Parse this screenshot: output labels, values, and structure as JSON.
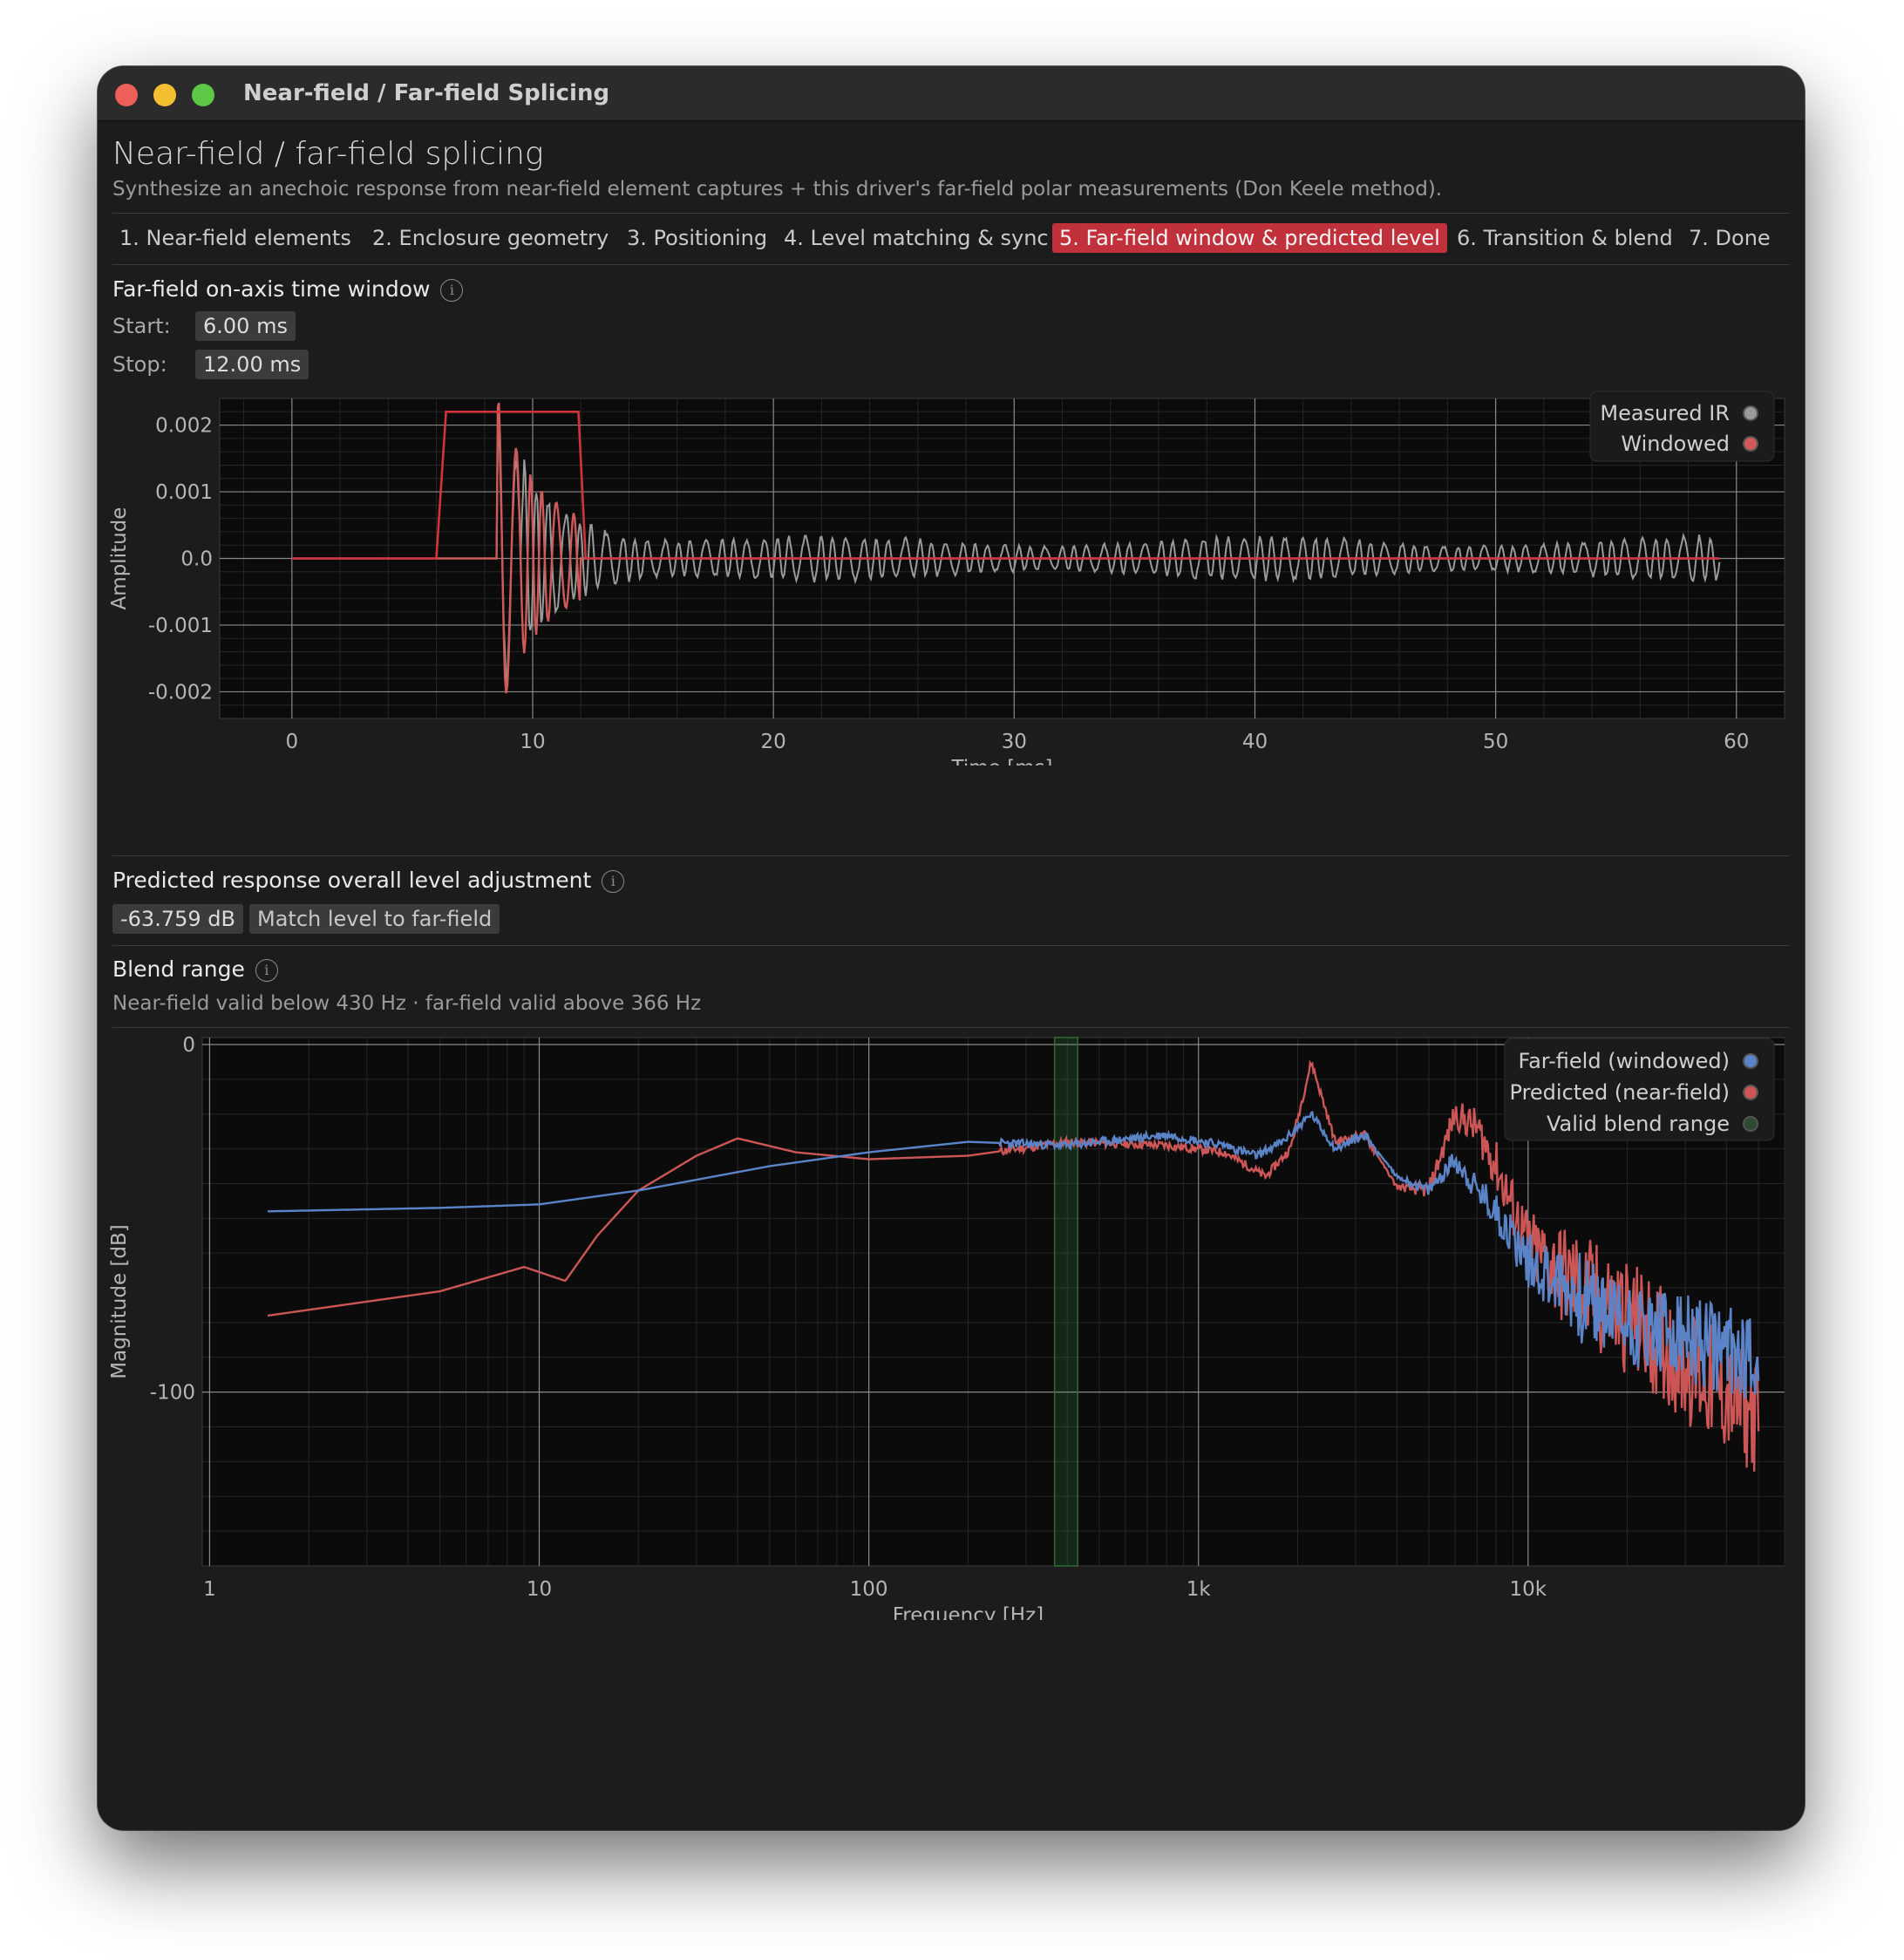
{
  "window": {
    "title": "Near-field / Far-field Splicing"
  },
  "header": {
    "title": "Near-field / far-field splicing",
    "subtitle": "Synthesize an anechoic response from near-field element captures + this driver's far-field polar measurements (Don Keele method)."
  },
  "tabs": [
    {
      "label": "1. Near-field elements",
      "active": false
    },
    {
      "label": "2. Enclosure geometry",
      "active": false
    },
    {
      "label": "3. Positioning",
      "active": false
    },
    {
      "label": "4. Level matching & sync",
      "active": false
    },
    {
      "label": "5. Far-field window & predicted level",
      "active": true
    },
    {
      "label": "6. Transition & blend",
      "active": false
    },
    {
      "label": "7. Done",
      "active": false
    }
  ],
  "window_section": {
    "title": "Far-field on-axis time window",
    "start_label": "Start:",
    "start_value": "6.00 ms",
    "stop_label": "Stop:",
    "stop_value": "12.00 ms"
  },
  "level_section": {
    "title": "Predicted response overall level adjustment",
    "value": "-63.759 dB",
    "match_button": "Match level to far-field"
  },
  "blend_section": {
    "title": "Blend range",
    "note": "Near-field valid below 430 Hz · far-field valid above 366 Hz"
  },
  "colors": {
    "accent": "#c0313c",
    "measured": "#9a9a9a",
    "windowed": "#d05a5a",
    "farfield": "#5b84c8",
    "predicted": "#cc5656",
    "blend": "#2f6b35"
  },
  "chart_data": [
    {
      "type": "line",
      "xlabel": "Time [ms]",
      "ylabel": "Amplitude",
      "xlim": [
        -3,
        62
      ],
      "ylim": [
        -0.0024,
        0.0024
      ],
      "x_ticks": [
        "0",
        "10",
        "20",
        "30",
        "40",
        "50",
        "60"
      ],
      "y_ticks": [
        "0.002",
        "0.001",
        "0.0",
        "-0.001",
        "-0.002"
      ],
      "grid": true,
      "legend": "top-right",
      "series": [
        {
          "name": "Measured IR",
          "color": "#9a9a9a",
          "x_range": [
            0,
            59.3
          ],
          "onset_ms": 8.5,
          "peak": 0.0022
        },
        {
          "name": "Windowed",
          "color": "#d05a5a",
          "window_ms": [
            6.0,
            12.0
          ],
          "window_level": 0.0022
        }
      ]
    },
    {
      "type": "line",
      "xlabel": "Frequency [Hz]",
      "ylabel": "Magnitude [dB]",
      "xscale": "log",
      "xlim": [
        0.95,
        60000
      ],
      "ylim": [
        -150,
        2
      ],
      "x_ticks": [
        "1",
        "10",
        "100",
        "1k",
        "10k"
      ],
      "y_ticks": [
        "0",
        "-100"
      ],
      "grid": true,
      "legend": "top-right",
      "series": [
        {
          "name": "Far-field (windowed)",
          "color": "#5b84c8",
          "points": [
            [
              1.5,
              -48
            ],
            [
              5,
              -47
            ],
            [
              10,
              -46
            ],
            [
              20,
              -42
            ],
            [
              50,
              -35
            ],
            [
              100,
              -31
            ],
            [
              200,
              -28
            ],
            [
              400,
              -29
            ],
            [
              800,
              -26
            ],
            [
              1200,
              -29
            ],
            [
              1500,
              -32
            ],
            [
              1800,
              -28
            ],
            [
              2200,
              -20
            ],
            [
              2600,
              -30
            ],
            [
              3200,
              -26
            ],
            [
              4000,
              -38
            ],
            [
              5000,
              -42
            ],
            [
              6000,
              -33
            ],
            [
              7000,
              -42
            ],
            [
              8000,
              -48
            ],
            [
              10000,
              -62
            ],
            [
              15000,
              -74
            ],
            [
              20000,
              -80
            ],
            [
              30000,
              -85
            ],
            [
              50000,
              -90
            ]
          ]
        },
        {
          "name": "Predicted (near-field)",
          "color": "#cc5656",
          "points": [
            [
              1.5,
              -78
            ],
            [
              5,
              -71
            ],
            [
              9,
              -64
            ],
            [
              12,
              -68
            ],
            [
              15,
              -55
            ],
            [
              20,
              -42
            ],
            [
              30,
              -32
            ],
            [
              40,
              -27
            ],
            [
              60,
              -31
            ],
            [
              100,
              -33
            ],
            [
              200,
              -32
            ],
            [
              400,
              -28
            ],
            [
              800,
              -29
            ],
            [
              1200,
              -31
            ],
            [
              1600,
              -38
            ],
            [
              1900,
              -30
            ],
            [
              2200,
              -5
            ],
            [
              2600,
              -28
            ],
            [
              3200,
              -26
            ],
            [
              4000,
              -41
            ],
            [
              5000,
              -42
            ],
            [
              6000,
              -20
            ],
            [
              7000,
              -24
            ],
            [
              8000,
              -35
            ],
            [
              10000,
              -58
            ],
            [
              15000,
              -72
            ],
            [
              20000,
              -78
            ],
            [
              30000,
              -92
            ],
            [
              50000,
              -108
            ]
          ]
        },
        {
          "name": "Valid blend range",
          "color": "#2f6b35",
          "range_hz": [
            366,
            430
          ]
        }
      ]
    }
  ]
}
